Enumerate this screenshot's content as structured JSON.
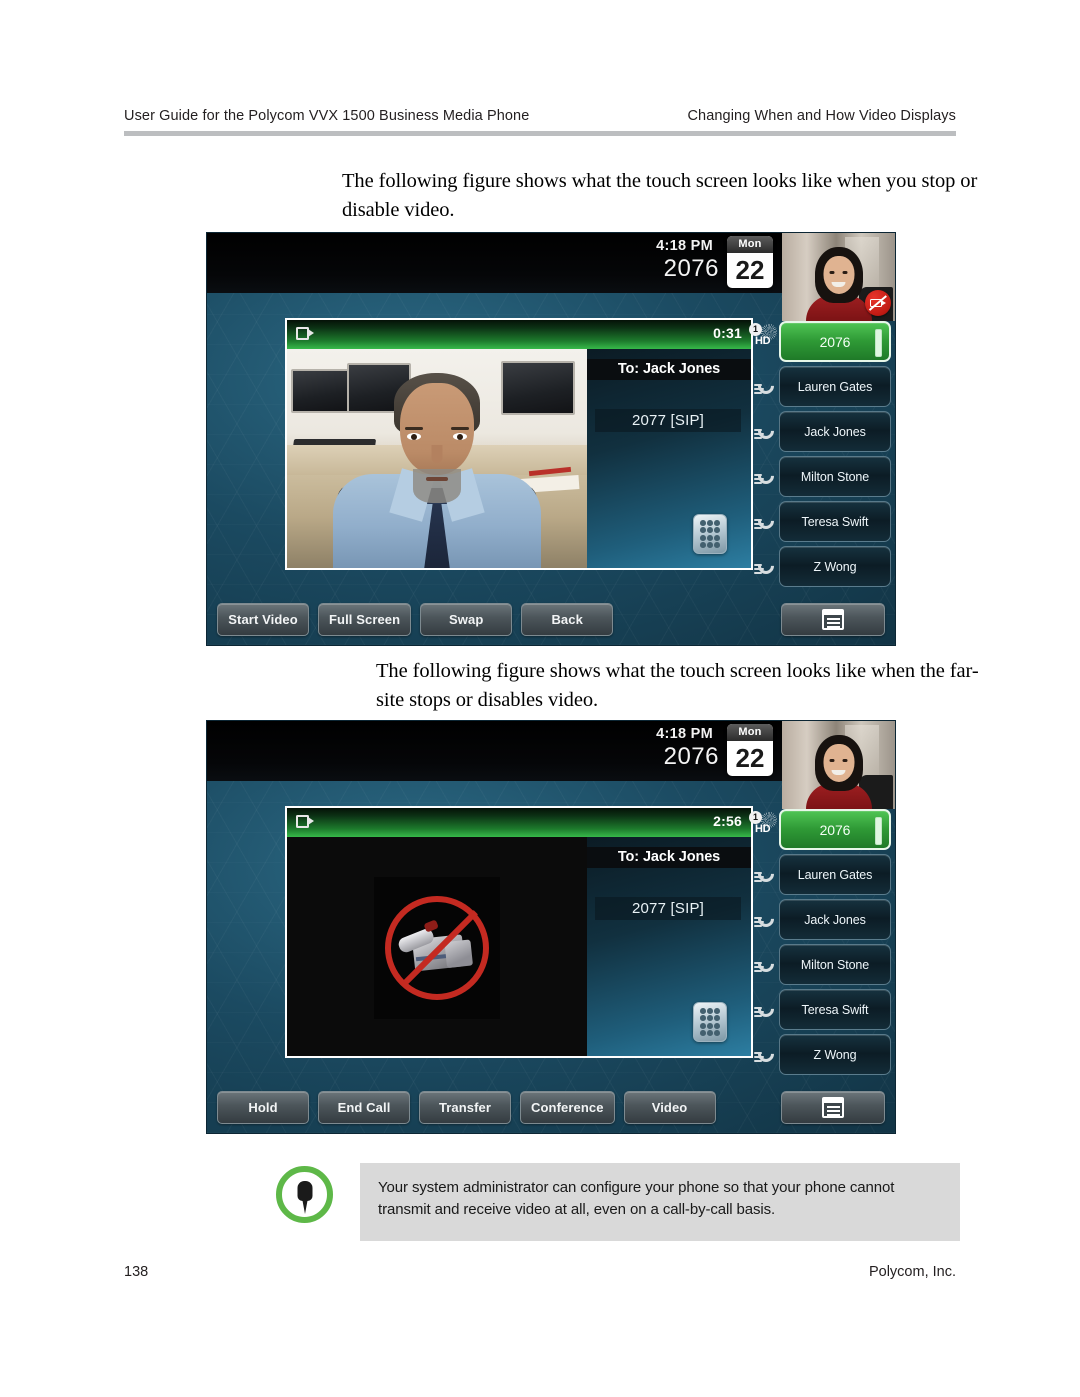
{
  "header": {
    "left": "User Guide for the Polycom VVX 1500 Business Media Phone",
    "right": "Changing When and How Video Displays"
  },
  "body": {
    "paragraph_1": "The following figure shows what the touch screen looks like when you stop or disable video.",
    "paragraph_2": "The following figure shows what the touch screen looks like when the far-site stops or disables video."
  },
  "figure_1": {
    "status": {
      "time": "4:18 PM",
      "extension": "2076",
      "calendar_weekday": "Mon",
      "calendar_day": "22"
    },
    "call": {
      "timer": "0:31",
      "to_label": "To: Jack Jones",
      "to_number": "2077 [SIP]",
      "camera_icon": "video-camera-icon",
      "keypad_icon": "keypad-icon",
      "video_state": "near-end video stopped"
    },
    "pip": {
      "self_view_badge": "video-off-badge",
      "badge_visible": true
    },
    "hd_indicator": {
      "line_number": "1",
      "label": "HD"
    },
    "line_keys": [
      {
        "label": "2076",
        "active": true,
        "icon": "line-active-icon"
      },
      {
        "label": "Lauren Gates",
        "active": false,
        "icon": "handset-icon"
      },
      {
        "label": "Jack Jones",
        "active": false,
        "icon": "handset-icon"
      },
      {
        "label": "Milton Stone",
        "active": false,
        "icon": "handset-icon"
      },
      {
        "label": "Teresa Swift",
        "active": false,
        "icon": "handset-icon"
      },
      {
        "label": "Z Wong",
        "active": false,
        "icon": "handset-icon"
      }
    ],
    "soft_keys": [
      "Start Video",
      "Full Screen",
      "Swap",
      "Back"
    ],
    "menu_key_icon": "menu-icon"
  },
  "figure_2": {
    "status": {
      "time": "4:18 PM",
      "extension": "2076",
      "calendar_weekday": "Mon",
      "calendar_day": "22"
    },
    "call": {
      "timer": "2:56",
      "to_label": "To: Jack Jones",
      "to_number": "2077 [SIP]",
      "camera_icon": "video-camera-icon",
      "keypad_icon": "keypad-icon",
      "video_state": "far-site video stopped",
      "placeholder_icon": "camera-prohibited-icon"
    },
    "pip": {
      "self_view_badge": "none",
      "badge_visible": false
    },
    "hd_indicator": {
      "line_number": "1",
      "label": "HD"
    },
    "line_keys": [
      {
        "label": "2076",
        "active": true,
        "icon": "line-active-icon"
      },
      {
        "label": "Lauren Gates",
        "active": false,
        "icon": "handset-icon"
      },
      {
        "label": "Jack Jones",
        "active": false,
        "icon": "handset-icon"
      },
      {
        "label": "Milton Stone",
        "active": false,
        "icon": "handset-icon"
      },
      {
        "label": "Teresa Swift",
        "active": false,
        "icon": "handset-icon"
      },
      {
        "label": "Z Wong",
        "active": false,
        "icon": "handset-icon"
      }
    ],
    "soft_keys": [
      "Hold",
      "End Call",
      "Transfer",
      "Conference",
      "Video"
    ],
    "menu_key_icon": "menu-icon"
  },
  "note": {
    "icon": "pushpin-icon",
    "icon_color": "#5eb848",
    "text": "Your system administrator can configure your phone so that your phone cannot transmit and receive video at all, even on a call-by-call basis."
  },
  "footer": {
    "page_number": "138",
    "company": "Polycom, Inc."
  },
  "colors": {
    "header_rule": "#bcbec0",
    "note_background": "#d9d9d9",
    "line_key_active": "#2f9a36",
    "prohibit_red": "#c42a21"
  }
}
